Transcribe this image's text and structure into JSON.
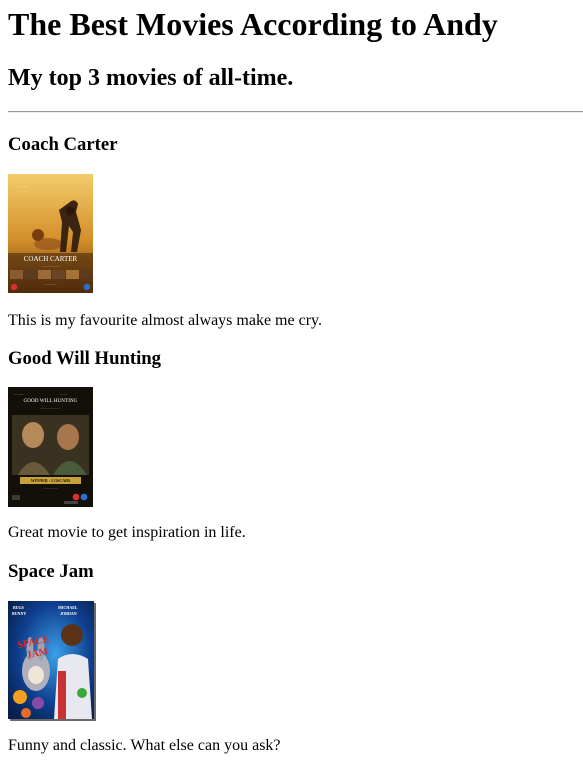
{
  "page": {
    "title": "The Best Movies According to Andy",
    "subtitle": "My top 3 movies of all-time."
  },
  "movies": [
    {
      "title": "Coach Carter",
      "description": "This is my favourite almost always make me cry.",
      "poster": {
        "icon": "coach-carter-poster",
        "title_text": "COACH CARTER",
        "colors": {
          "sky": "#e2b04a",
          "ground": "#6b3a12",
          "band": "#3a2008"
        }
      }
    },
    {
      "title": "Good Will Hunting",
      "description": "Great movie to get inspiration in life.",
      "poster": {
        "icon": "good-will-hunting-poster",
        "title_text": "GOOD WILL HUNTING",
        "banner_text": "WINNER - 2 OSCARS",
        "colors": {
          "bg": "#121008",
          "banner": "#c7a23a"
        }
      }
    },
    {
      "title": "Space Jam",
      "description": "Funny and classic. What else can you ask?",
      "poster": {
        "icon": "space-jam-poster",
        "top_left_text": "BUGS BUNNY",
        "top_right_text": "MICHAEL JORDAN",
        "logo_text": "SPACE JAM",
        "colors": {
          "bg": "#0f3f8f",
          "logo": "#d92b2b"
        }
      }
    }
  ]
}
